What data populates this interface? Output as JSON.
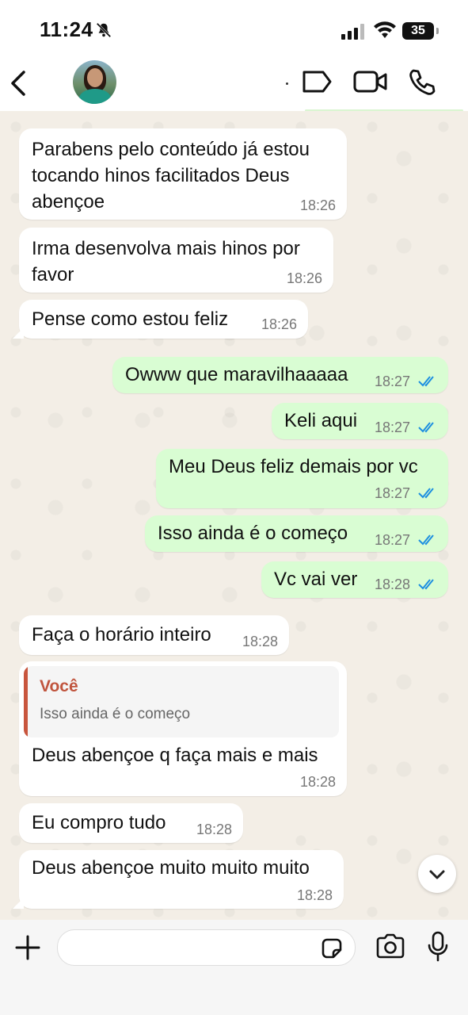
{
  "status_bar": {
    "time": "11:24",
    "battery": "35"
  },
  "header": {
    "contact_name": ""
  },
  "messages": [
    {
      "dir": "in",
      "text": "Parabens pelo conteúdo já estou\ntocando hinos facilitados Deus\nabençoe",
      "time": "18:26"
    },
    {
      "dir": "in",
      "text": "Irma desenvolva mais hinos por\nfavor",
      "time": "18:26"
    },
    {
      "dir": "in",
      "text": "Pense como estou feliz",
      "time": "18:26"
    },
    {
      "dir": "out",
      "text": "Owww que maravilhaaaaa",
      "time": "18:27"
    },
    {
      "dir": "out",
      "text": "Keli aqui",
      "time": "18:27"
    },
    {
      "dir": "out",
      "text": "Meu Deus feliz demais por vc",
      "time": "18:27"
    },
    {
      "dir": "out",
      "text": "Isso ainda é o começo",
      "time": "18:27"
    },
    {
      "dir": "out",
      "text": "Vc vai ver",
      "time": "18:28"
    },
    {
      "dir": "in",
      "text": "Faça o horário inteiro",
      "time": "18:28"
    },
    {
      "dir": "in",
      "text": "Deus abençoe q faça mais e mais",
      "time": "18:28",
      "reply_to": {
        "author": "Você",
        "text": "Isso ainda é o começo"
      }
    },
    {
      "dir": "in",
      "text": "Eu compro tudo",
      "time": "18:28"
    },
    {
      "dir": "in",
      "text": "Deus abençoe muito muito muito",
      "time": "18:28"
    }
  ],
  "composer": {
    "placeholder": ""
  },
  "colors": {
    "incoming": "#ffffff",
    "outgoing": "#d9fdd3",
    "read_ticks": "#1d8fe0",
    "reply_accent": "#c8553d"
  },
  "icons": {
    "back": "chevron-left-icon",
    "label": "label-icon",
    "video": "video-camera-icon",
    "phone": "phone-icon",
    "scroll_down": "chevron-down-icon",
    "attach": "plus-icon",
    "sticker": "sticker-icon",
    "camera": "camera-icon",
    "mic": "microphone-icon"
  }
}
